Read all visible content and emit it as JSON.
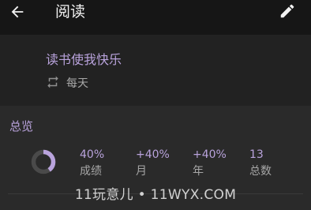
{
  "header": {
    "title": "阅读",
    "back_icon": "arrow-back-icon",
    "edit_icon": "pencil-icon"
  },
  "habit": {
    "name": "读书使我快乐",
    "frequency_icon": "repeat-icon",
    "frequency": "每天"
  },
  "overview": {
    "title": "总览",
    "score_fraction": 0.4,
    "stats": [
      {
        "value": "40%",
        "label": "成绩"
      },
      {
        "value": "+40%",
        "label": "月"
      },
      {
        "value": "+40%",
        "label": "年"
      },
      {
        "value": "13",
        "label": "总数"
      }
    ]
  },
  "watermark": "11玩意儿 • 11WYX.COM",
  "colors": {
    "accent": "#b9a3dc",
    "ring_track": "#4a4a4a",
    "header_bg": "#161616",
    "card_bg": "#2a2a2a"
  }
}
